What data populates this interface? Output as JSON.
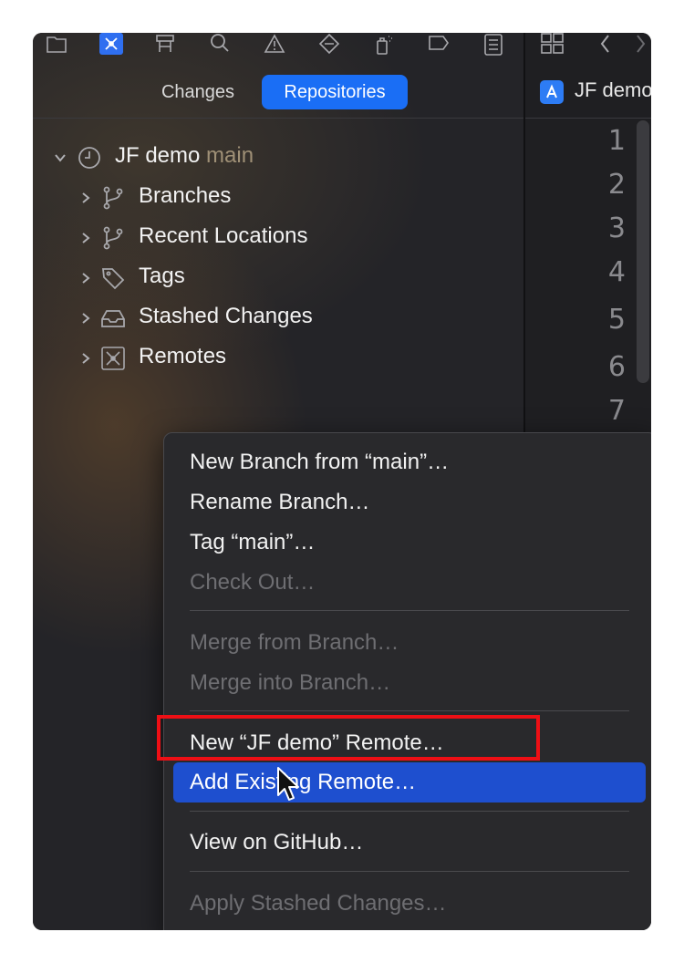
{
  "segmented": {
    "changes": "Changes",
    "repositories": "Repositories"
  },
  "editor": {
    "tab_title": "JF demo",
    "line_numbers": [
      "1",
      "2",
      "3",
      "4",
      "5",
      "6",
      "7"
    ]
  },
  "tree": {
    "repo": {
      "name": "JF demo",
      "branch": "main"
    },
    "items": [
      {
        "label": "Branches"
      },
      {
        "label": "Recent Locations"
      },
      {
        "label": "Tags"
      },
      {
        "label": "Stashed Changes"
      },
      {
        "label": "Remotes"
      }
    ]
  },
  "menu": {
    "new_branch": "New Branch from “main”…",
    "rename_branch": "Rename Branch…",
    "tag_main": "Tag “main”…",
    "check_out": "Check Out…",
    "merge_from": "Merge from Branch…",
    "merge_into": "Merge into Branch…",
    "new_remote": "New “JF demo” Remote…",
    "add_existing_remote": "Add Existing Remote…",
    "view_github": "View on GitHub…",
    "apply_stashed": "Apply Stashed Changes…"
  },
  "colors": {
    "accent": "#1a6ef5",
    "highlight": "#1e4fcf",
    "annotation": "#ee0f15"
  }
}
